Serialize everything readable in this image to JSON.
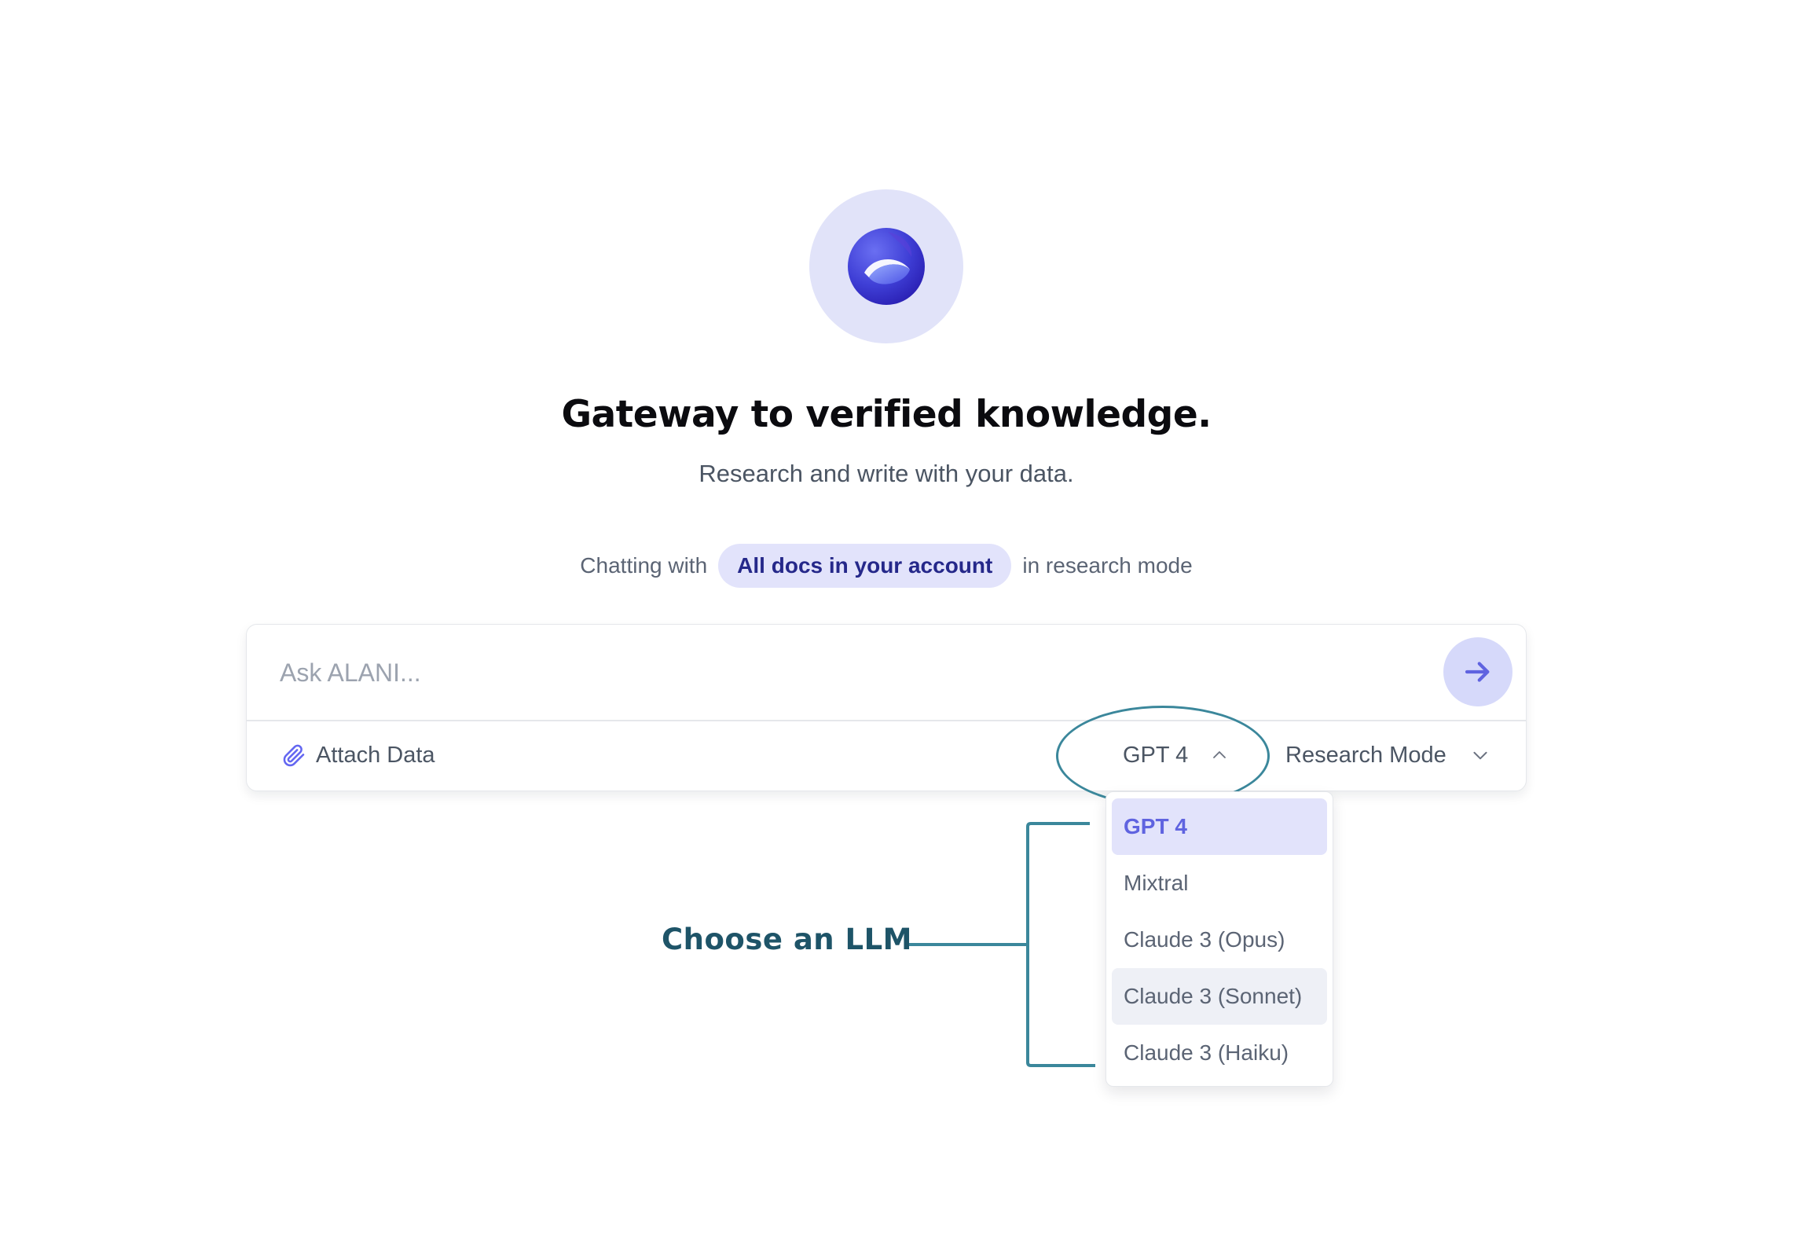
{
  "brand": {
    "logo_icon": "alani-logo-icon",
    "colors": {
      "accent": "#5f63e0",
      "logo_bg": "#e1e3f9",
      "chip_bg": "#e2e3fb",
      "chip_text": "#25288a",
      "annotation": "#3b879b",
      "annotation_text": "#1e5468"
    }
  },
  "hero": {
    "title": "Gateway to verified knowledge.",
    "subtitle": "Research and write with your data."
  },
  "context": {
    "prefix": "Chatting with",
    "chip": "All docs in your account",
    "suffix": "in research mode"
  },
  "chat": {
    "placeholder": "Ask ALANI...",
    "value": "",
    "send_icon": "arrow-right-icon",
    "attach_label": "Attach Data",
    "attach_icon": "paperclip-icon",
    "model_label": "GPT 4",
    "model_icon": "chevron-up-icon",
    "mode_label": "Research Mode",
    "mode_icon": "chevron-down-icon"
  },
  "model_dropdown": {
    "options": [
      {
        "label": "GPT 4",
        "state": "selected"
      },
      {
        "label": "Mixtral",
        "state": "default"
      },
      {
        "label": "Claude 3 (Opus)",
        "state": "default"
      },
      {
        "label": "Claude 3 (Sonnet)",
        "state": "hovered"
      },
      {
        "label": "Claude 3 (Haiku)",
        "state": "default"
      }
    ]
  },
  "annotation": {
    "label": "Choose an LLM"
  }
}
